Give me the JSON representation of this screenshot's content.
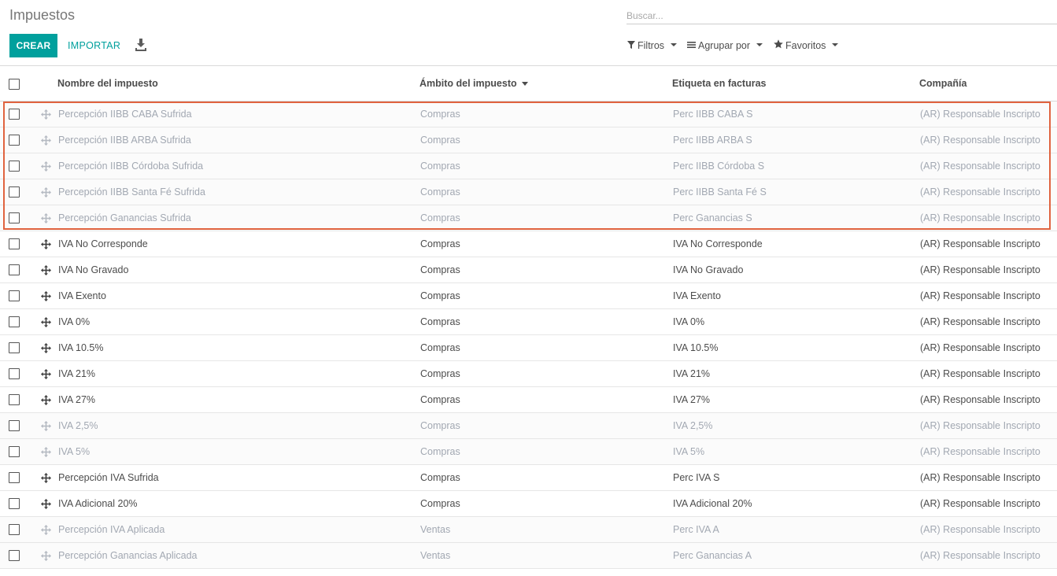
{
  "breadcrumb": "Impuestos",
  "search": {
    "placeholder": "Buscar..."
  },
  "buttons": {
    "create": "CREAR",
    "import": "IMPORTAR"
  },
  "filters": {
    "filters": "Filtros",
    "group_by": "Agrupar por",
    "favorites": "Favoritos"
  },
  "columns": {
    "name": "Nombre del impuesto",
    "scope": "Ámbito del impuesto",
    "label": "Etiqueta en facturas",
    "company": "Compañía"
  },
  "rows": [
    {
      "name": "Percepción IIBB CABA Sufrida",
      "scope": "Compras",
      "label": "Perc IIBB CABA S",
      "company": "(AR) Responsable Inscripto",
      "muted": true
    },
    {
      "name": "Percepción IIBB ARBA Sufrida",
      "scope": "Compras",
      "label": "Perc IIBB ARBA S",
      "company": "(AR) Responsable Inscripto",
      "muted": true
    },
    {
      "name": "Percepción IIBB Córdoba Sufrida",
      "scope": "Compras",
      "label": "Perc IIBB Córdoba S",
      "company": "(AR) Responsable Inscripto",
      "muted": true
    },
    {
      "name": "Percepción IIBB Santa Fé Sufrida",
      "scope": "Compras",
      "label": "Perc IIBB Santa Fé S",
      "company": "(AR) Responsable Inscripto",
      "muted": true
    },
    {
      "name": "Percepción Ganancias Sufrida",
      "scope": "Compras",
      "label": "Perc Ganancias S",
      "company": "(AR) Responsable Inscripto",
      "muted": true
    },
    {
      "name": "IVA No Corresponde",
      "scope": "Compras",
      "label": "IVA No Corresponde",
      "company": "(AR) Responsable Inscripto",
      "muted": false
    },
    {
      "name": "IVA No Gravado",
      "scope": "Compras",
      "label": "IVA No Gravado",
      "company": "(AR) Responsable Inscripto",
      "muted": false
    },
    {
      "name": "IVA Exento",
      "scope": "Compras",
      "label": "IVA Exento",
      "company": "(AR) Responsable Inscripto",
      "muted": false
    },
    {
      "name": "IVA 0%",
      "scope": "Compras",
      "label": "IVA 0%",
      "company": "(AR) Responsable Inscripto",
      "muted": false
    },
    {
      "name": "IVA 10.5%",
      "scope": "Compras",
      "label": "IVA 10.5%",
      "company": "(AR) Responsable Inscripto",
      "muted": false
    },
    {
      "name": "IVA 21%",
      "scope": "Compras",
      "label": "IVA 21%",
      "company": "(AR) Responsable Inscripto",
      "muted": false
    },
    {
      "name": "IVA 27%",
      "scope": "Compras",
      "label": "IVA 27%",
      "company": "(AR) Responsable Inscripto",
      "muted": false
    },
    {
      "name": "IVA 2,5%",
      "scope": "Compras",
      "label": "IVA 2,5%",
      "company": "(AR) Responsable Inscripto",
      "muted": true
    },
    {
      "name": "IVA 5%",
      "scope": "Compras",
      "label": "IVA 5%",
      "company": "(AR) Responsable Inscripto",
      "muted": true
    },
    {
      "name": "Percepción IVA Sufrida",
      "scope": "Compras",
      "label": "Perc IVA S",
      "company": "(AR) Responsable Inscripto",
      "muted": false
    },
    {
      "name": "IVA Adicional 20%",
      "scope": "Compras",
      "label": "IVA Adicional 20%",
      "company": "(AR) Responsable Inscripto",
      "muted": false
    },
    {
      "name": "Percepción IVA Aplicada",
      "scope": "Ventas",
      "label": "Perc IVA A",
      "company": "(AR) Responsable Inscripto",
      "muted": true
    },
    {
      "name": "Percepción Ganancias Aplicada",
      "scope": "Ventas",
      "label": "Perc Ganancias A",
      "company": "(AR) Responsable Inscripto",
      "muted": true
    }
  ],
  "colors": {
    "accent": "#00a09d",
    "highlight_border": "#e0633f",
    "muted_text": "#a2a8b2"
  },
  "icons": {
    "download": "download-icon",
    "filter": "funnel-icon",
    "group": "bars-icon",
    "favorites": "star-icon",
    "drag": "drag-handle-icon"
  }
}
